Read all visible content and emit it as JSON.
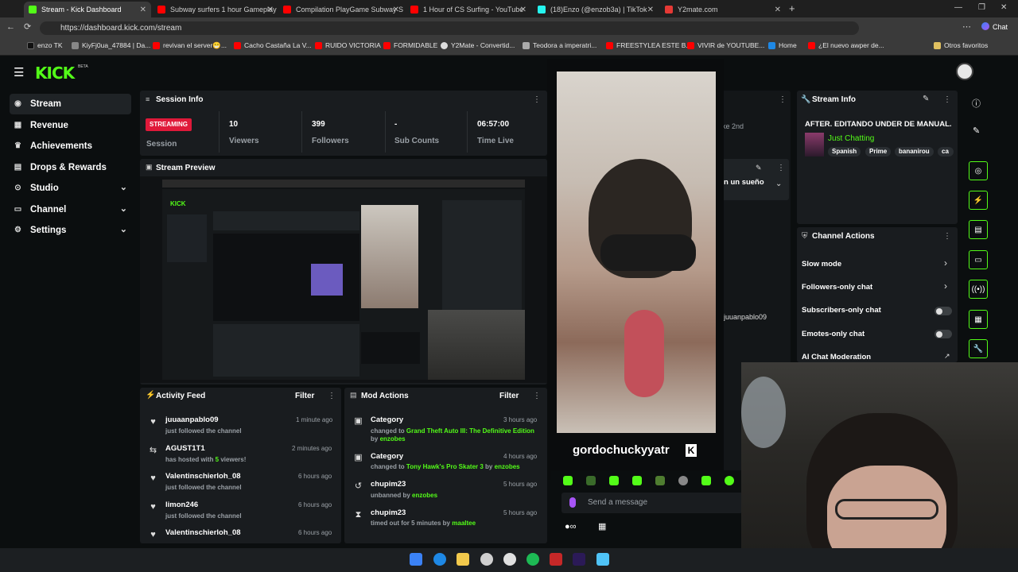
{
  "browser": {
    "tabs": [
      {
        "title": "Stream - Kick Dashboard",
        "color": "#53fc18"
      },
      {
        "title": "Subway surfers 1 hour Gameplay",
        "color": "#ff0000"
      },
      {
        "title": "Compilation PlayGame Subway S",
        "color": "#ff0000"
      },
      {
        "title": "1 Hour of CS Surfing - YouTube",
        "color": "#ff0000"
      },
      {
        "title": "(18)Enzo (@enzob3a) | TikTok",
        "color": "#25f4ee"
      },
      {
        "title": "Y2mate.com",
        "color": "#e53935"
      }
    ],
    "url": "https://dashboard.kick.com/stream",
    "chat_label": "Chat",
    "bookmarks": [
      "enzo TK",
      "KiyFj0ua_47884 | Da...",
      "revivan el server😁...",
      "Cacho Castaña La V...",
      "RUIDO VICTORIA",
      "FORMIDABLE",
      "Y2Mate - Convertid...",
      "Teodora a imperatri...",
      "FREESTYLEA ESTE B...",
      "VIVIR de YOUTUBE...",
      "Home",
      "¿El nuevo awper de..."
    ],
    "other_favorites": "Otros favoritos"
  },
  "brand": {
    "logo": "KICK",
    "logo_badge": "BETA",
    "accent": "#53fc18"
  },
  "sidebar": {
    "items": [
      {
        "label": "Stream",
        "icon": "stream-icon"
      },
      {
        "label": "Revenue",
        "icon": "revenue-icon"
      },
      {
        "label": "Achievements",
        "icon": "trophy-icon"
      },
      {
        "label": "Drops & Rewards",
        "icon": "drops-icon"
      },
      {
        "label": "Studio",
        "icon": "studio-icon"
      },
      {
        "label": "Channel",
        "icon": "channel-icon"
      },
      {
        "label": "Settings",
        "icon": "gear-icon"
      }
    ]
  },
  "session_info": {
    "title": "Session Info",
    "status": "STREAMING",
    "status_label": "Session",
    "stats": [
      {
        "value": "10",
        "label": "Viewers"
      },
      {
        "value": "399",
        "label": "Followers"
      },
      {
        "value": "-",
        "label": "Sub Counts"
      },
      {
        "value": "06:57:00",
        "label": "Time Live"
      }
    ]
  },
  "stream_preview": {
    "title": "Stream Preview"
  },
  "activity_feed": {
    "title": "Activity Feed",
    "filter": "Filter",
    "items": [
      {
        "name": "juuaanpablo09",
        "sub": "just followed the channel",
        "time": "1 minute ago",
        "icon": "heart-icon"
      },
      {
        "name": "AGUST1T1",
        "sub": "has hosted with 5 viewers!",
        "time": "2 minutes ago",
        "icon": "host-icon"
      },
      {
        "name": "Valentinschierloh_08",
        "sub": "just followed the channel",
        "time": "6 hours ago",
        "icon": "heart-icon"
      },
      {
        "name": "limon246",
        "sub": "just followed the channel",
        "time": "6 hours ago",
        "icon": "heart-icon"
      },
      {
        "name": "Valentinschierloh_08",
        "sub": "",
        "time": "6 hours ago",
        "icon": "heart-icon"
      }
    ]
  },
  "mod_actions": {
    "title": "Mod Actions",
    "filter": "Filter",
    "items": [
      {
        "name": "Category",
        "pre": "changed to",
        "target": "Grand Theft Auto III: The Definitive Edition",
        "by": "by",
        "mod": "enzobes",
        "time": "3 hours ago"
      },
      {
        "name": "Category",
        "pre": "changed to",
        "target": "Tony Hawk's Pro Skater 3",
        "by": "by",
        "mod": "enzobes",
        "time": "4 hours ago"
      },
      {
        "name": "chupim23",
        "pre": "unbanned by",
        "target": "",
        "by": "",
        "mod": "enzobes",
        "time": "5 hours ago"
      },
      {
        "name": "chupim23",
        "pre": "timed out for 5 minutes by",
        "target": "",
        "by": "",
        "mod": "maaltee",
        "time": "5 hours ago"
      }
    ]
  },
  "overlay": {
    "streamer_name": "gordochuckyyatr",
    "chat_placeholder": "Send a message",
    "partial_text_1": "ke 2nd",
    "partial_text_2": "n un sueño",
    "partial_text_3": "juuanpablo09"
  },
  "stream_info": {
    "title": "Stream Info",
    "stream_title": "AFTER. EDITANDO UNDER DE MANUAL.",
    "category": "Just Chatting",
    "tags": [
      "Spanish",
      "Prime",
      "bananirou",
      "ca"
    ]
  },
  "channel_actions": {
    "title": "Channel Actions",
    "items": [
      {
        "label": "Slow mode",
        "control": "chevron"
      },
      {
        "label": "Followers-only chat",
        "control": "chevron"
      },
      {
        "label": "Subscribers-only chat",
        "control": "toggle"
      },
      {
        "label": "Emotes-only chat",
        "control": "toggle"
      },
      {
        "label": "AI Chat Moderation",
        "control": "external"
      }
    ]
  }
}
